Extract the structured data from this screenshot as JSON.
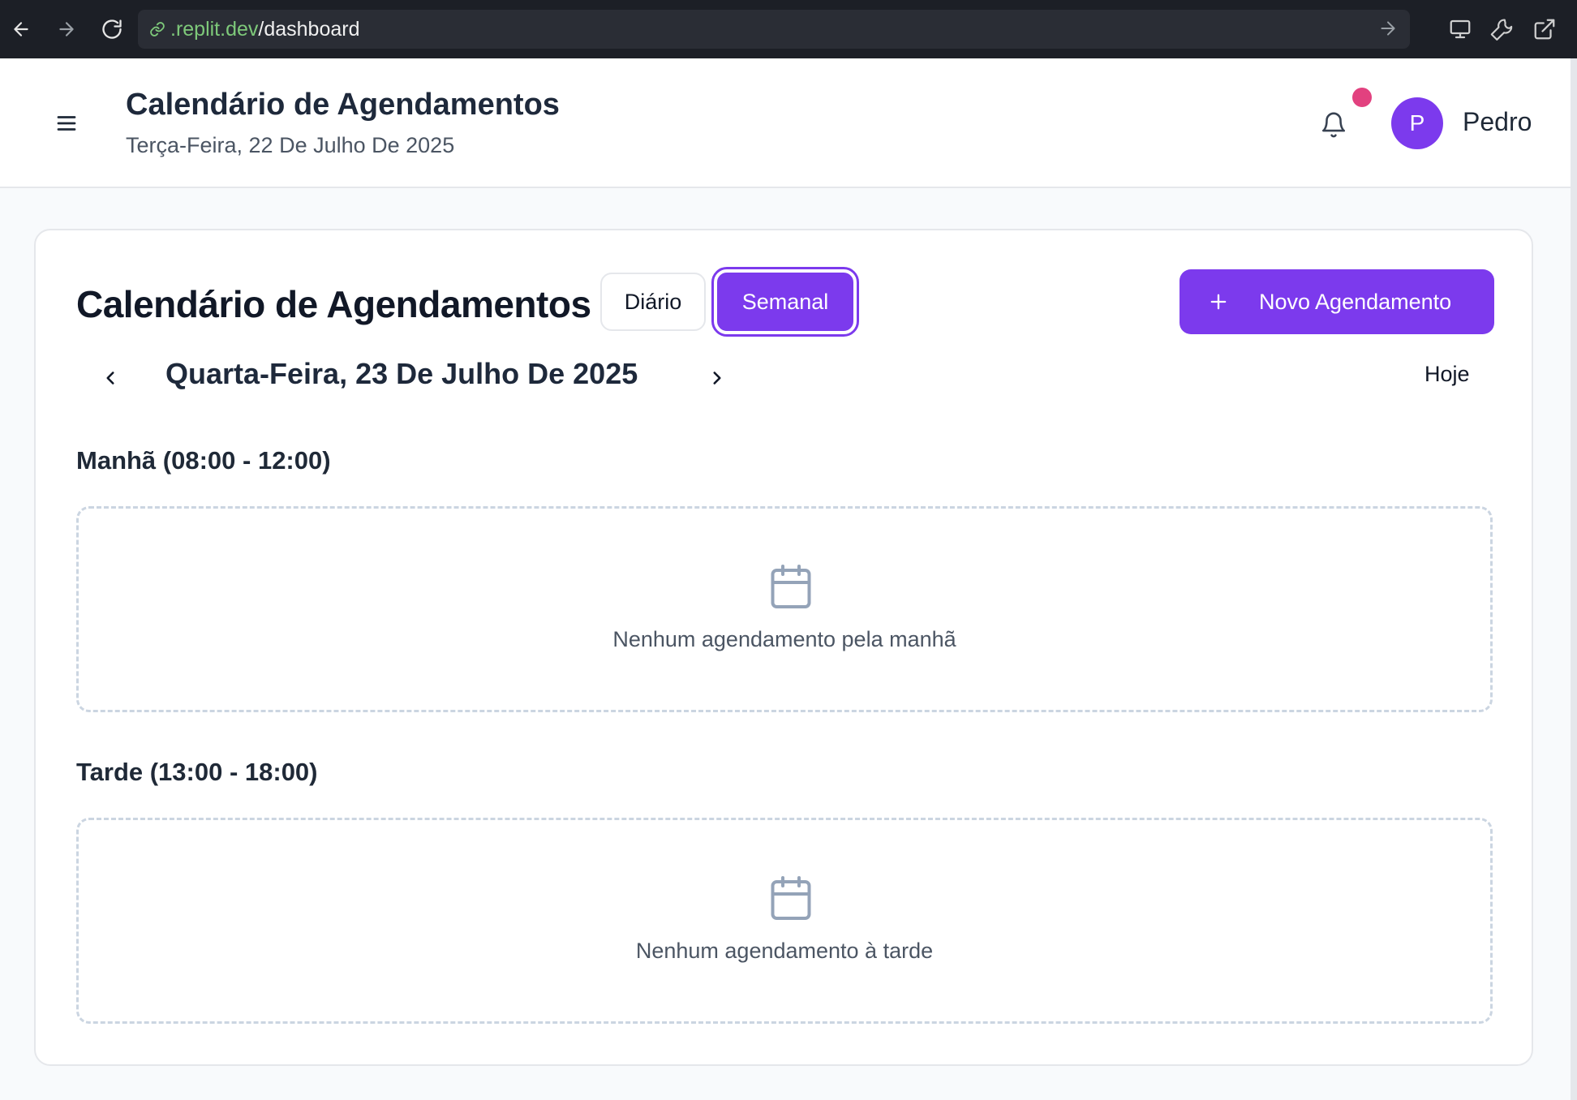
{
  "browser": {
    "url_domain": ".replit.dev",
    "url_path": "/dashboard"
  },
  "header": {
    "title": "Calendário de Agendamentos",
    "date": "Terça-Feira, 22 De Julho De 2025",
    "avatar_initial": "P",
    "user_name": "Pedro",
    "notification_dot_color": "#e2417f"
  },
  "calendar": {
    "title": "Calendário de Agendamentos",
    "view_daily_label": "Diário",
    "view_weekly_label": "Semanal",
    "active_view": "Semanal",
    "new_button_label": "Novo Agendamento",
    "current_date": "Quarta-Feira, 23 De Julho De 2025",
    "today_label": "Hoje",
    "sections": [
      {
        "label": "Manhã (08:00 - 12:00)",
        "empty_text": "Nenhum agendamento pela manhã"
      },
      {
        "label": "Tarde (13:00 - 18:00)",
        "empty_text": "Nenhum agendamento à tarde"
      }
    ]
  },
  "icons": [
    "back-icon",
    "forward-icon",
    "reload-icon",
    "link-icon",
    "go-icon",
    "monitor-icon",
    "wrench-icon",
    "external-link-icon",
    "menu-icon",
    "bell-icon",
    "plus-icon",
    "chevron-left-icon",
    "chevron-right-icon",
    "calendar-icon"
  ],
  "colors": {
    "accent": "#7c3aed",
    "chrome_bg": "#1c1f26",
    "domain_green": "#7ec97a"
  }
}
